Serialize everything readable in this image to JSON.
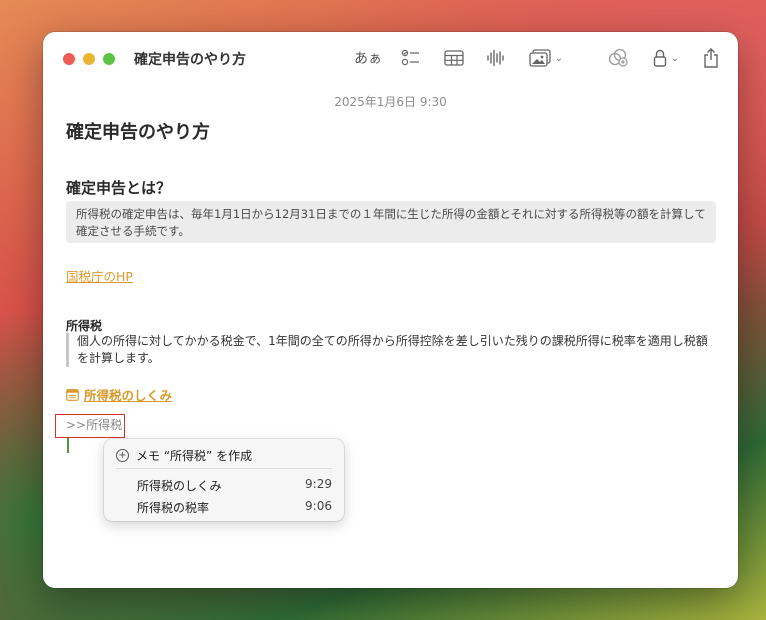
{
  "window": {
    "title": "確定申告のやり方"
  },
  "toolbar": {
    "format_label": "あぁ",
    "icons": [
      "checklist-icon",
      "table-icon",
      "audio-icon",
      "media-icon",
      "collaborate-icon",
      "lock-icon",
      "share-icon"
    ]
  },
  "note": {
    "timestamp": "2025年1月6日 9:30",
    "title": "確定申告のやり方",
    "section_heading": "確定申告とは？",
    "definition": "所得税の確定申告は、毎年1月1日から12月31日までの１年間に生じた所得の金額とそれに対する所得税等の額を計算して確定させる手続です。",
    "link_nta": "国税庁のHP",
    "sub_heading": "所得税",
    "quote": "個人の所得に対してかかる税金で、1年間の全ての所得から所得控除を差し引いた残りの課税所得に税率を適用し税額を計算します。",
    "note_link": "所得税のしくみ",
    "typed_text": ">>所得税"
  },
  "popup": {
    "create_label": "メモ “所得税” を作成",
    "items": [
      {
        "title": "所得税のしくみ",
        "time": "9:29"
      },
      {
        "title": "所得税の税率",
        "time": "9:06"
      }
    ]
  },
  "colors": {
    "link": "#d99a2b",
    "highlight_border": "#d2332b",
    "traffic_red": "#ee5d55",
    "traffic_yellow": "#e7b531",
    "traffic_green": "#5cc445"
  }
}
